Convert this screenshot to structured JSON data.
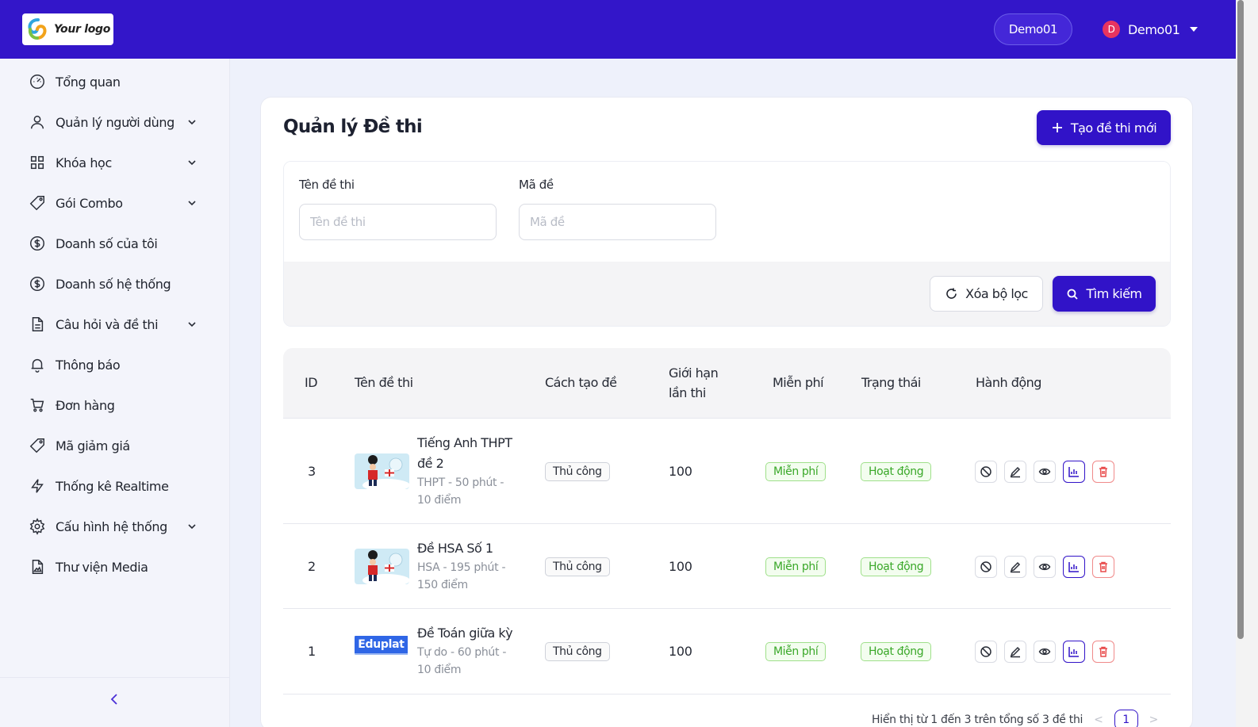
{
  "header": {
    "logo_text": "Your logo",
    "pill_label": "Demo01",
    "user_initial": "D",
    "user_name": "Demo01"
  },
  "sidebar": {
    "items": [
      {
        "label": "Tổng quan",
        "icon": "gauge-icon",
        "expandable": false
      },
      {
        "label": "Quản lý người dùng",
        "icon": "user-icon",
        "expandable": true
      },
      {
        "label": "Khóa học",
        "icon": "grid-icon",
        "expandable": true
      },
      {
        "label": "Gói Combo",
        "icon": "tag-icon",
        "expandable": true
      },
      {
        "label": "Doanh số của tôi",
        "icon": "dollar-icon",
        "expandable": false
      },
      {
        "label": "Doanh số hệ thống",
        "icon": "dollar-icon",
        "expandable": false
      },
      {
        "label": "Câu hỏi và đề thi",
        "icon": "document-icon",
        "expandable": true
      },
      {
        "label": "Thông báo",
        "icon": "bell-icon",
        "expandable": false
      },
      {
        "label": "Đơn hàng",
        "icon": "cart-icon",
        "expandable": false
      },
      {
        "label": "Mã giảm giá",
        "icon": "tag-icon",
        "expandable": false
      },
      {
        "label": "Thống kê Realtime",
        "icon": "bolt-icon",
        "expandable": false
      },
      {
        "label": "Cấu hình hệ thống",
        "icon": "gear-icon",
        "expandable": true
      },
      {
        "label": "Thư viện Media",
        "icon": "media-file-icon",
        "expandable": false
      }
    ]
  },
  "page": {
    "title": "Quản lý Đề thi",
    "create_button": "Tạo đề thi mới"
  },
  "filter": {
    "name_label": "Tên đề thi",
    "name_placeholder": "Tên đề thi",
    "name_value": "",
    "code_label": "Mã đề",
    "code_placeholder": "Mã đề",
    "code_value": "",
    "clear_button": "Xóa bộ lọc",
    "search_button": "Tìm kiếm"
  },
  "table": {
    "columns": {
      "id": "ID",
      "name": "Tên đề thi",
      "method": "Cách tạo đề",
      "limit_line1": "Giới hạn",
      "limit_line2": "lần thi",
      "free": "Miễn phí",
      "status": "Trạng thái",
      "actions": "Hành động"
    },
    "rows": [
      {
        "id": "3",
        "name_line1": "Tiếng Anh THPT",
        "name_line2": "đề 2",
        "meta_line1": "THPT - 50 phút -",
        "meta_line2": "10 điểm",
        "thumb": "guard",
        "method": "Thủ công",
        "limit": "100",
        "free": "Miễn phí",
        "status": "Hoạt động"
      },
      {
        "id": "2",
        "name_line1": "Đề HSA Số 1",
        "name_line2": "",
        "meta_line1": "HSA - 195 phút -",
        "meta_line2": "150 điểm",
        "thumb": "guard",
        "method": "Thủ công",
        "limit": "100",
        "free": "Miễn phí",
        "status": "Hoạt động"
      },
      {
        "id": "1",
        "name_line1": "Đề Toán giữa kỳ",
        "name_line2": "",
        "meta_line1": "Tự do - 60 phút -",
        "meta_line2": "10 điểm",
        "thumb": "eduplat",
        "thumb_text": "Eduplat",
        "method": "Thủ công",
        "limit": "100",
        "free": "Miễn phí",
        "status": "Hoạt động"
      }
    ]
  },
  "pagination": {
    "summary": "Hiển thị từ 1 đến 3 trên tổng số 3 đề thi",
    "current_page": "1",
    "prev": "<",
    "next": ">"
  },
  "colors": {
    "brand": "#3316c9",
    "primary_button": "#3113c8",
    "success": "#3aa829",
    "danger": "#e84a4a"
  }
}
